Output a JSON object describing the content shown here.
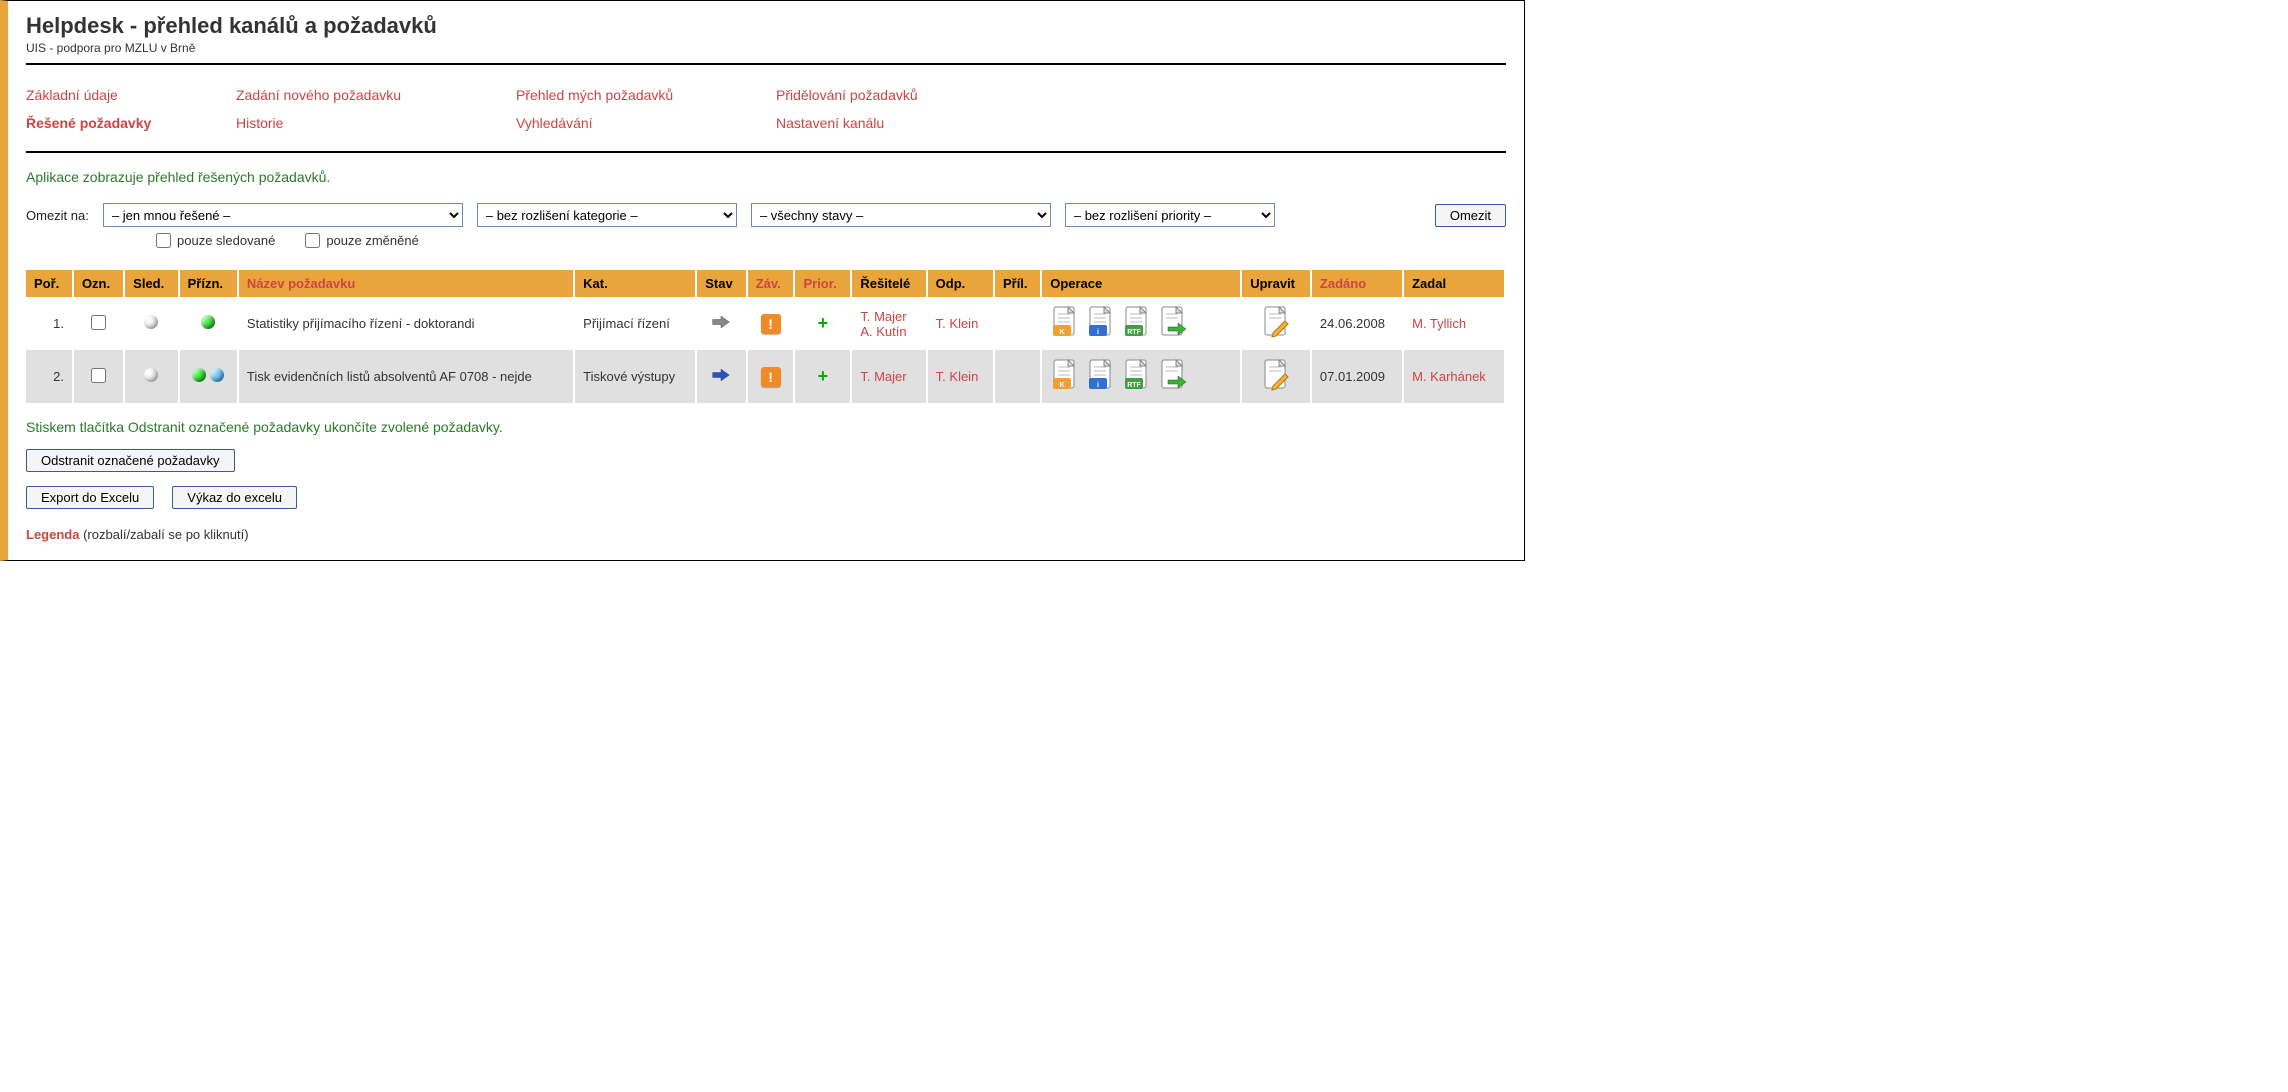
{
  "header": {
    "title": "Helpdesk - přehled kanálů a požadavků",
    "subtitle": "UIS - podpora pro MZLU v Brně"
  },
  "nav": {
    "row1": [
      "Základní údaje",
      "Zadání nového požadavku",
      "Přehled mých požadavků",
      "Přidělování požadavků"
    ],
    "row2": [
      "Řešené požadavky",
      "Historie",
      "Vyhledávání",
      "Nastavení kanálu"
    ],
    "active": "Řešené požadavky"
  },
  "intro": "Aplikace zobrazuje přehled řešených požadavků.",
  "filters": {
    "label": "Omezit na:",
    "select1": "– jen mnou řešené –",
    "select2": "– bez rozlišení kategorie –",
    "select3": "– všechny stavy –",
    "select4": "– bez rozlišení priority –",
    "submit": "Omezit",
    "chk1": "pouze sledované",
    "chk2": "pouze změněné"
  },
  "table": {
    "headers": {
      "por": "Poř.",
      "ozn": "Ozn.",
      "sled": "Sled.",
      "prizn": "Přízn.",
      "nazev": "Název požadavku",
      "kat": "Kat.",
      "stav": "Stav",
      "zav": "Záv.",
      "prior": "Prior.",
      "resitele": "Řešitelé",
      "odp": "Odp.",
      "pril": "Příl.",
      "operace": "Operace",
      "upravit": "Upravit",
      "zadano": "Zadáno",
      "zadal": "Zadal"
    },
    "rows": [
      {
        "por": "1.",
        "nazev": "Statistiky přijímacího řízení - doktorandi",
        "kat": "Přijímací řízení",
        "resitele": [
          "T. Majer",
          "A. Kutín"
        ],
        "odp": "T. Klein",
        "zadano": "24.06.2008",
        "zadal": "M. Tyllich",
        "arrow_color": "#888",
        "prizn_dots": [
          "green"
        ]
      },
      {
        "por": "2.",
        "nazev": "Tisk evidenčních listů absolventů AF 0708 - nejde",
        "kat": "Tiskové výstupy",
        "resitele": [
          "T. Majer"
        ],
        "odp": "T. Klein",
        "zadano": "07.01.2009",
        "zadal": "M. Karhánek",
        "arrow_color": "#2255cc",
        "prizn_dots": [
          "green",
          "blue"
        ]
      }
    ]
  },
  "hint": "Stiskem tlačítka Odstranit označené požadavky ukončíte zvolené požadavky.",
  "buttons": {
    "remove": "Odstranit označené požadavky",
    "export": "Export do Excelu",
    "vykaz": "Výkaz do excelu"
  },
  "legend": {
    "label": "Legenda",
    "hint": "(rozbalí/zabalí se po kliknutí)"
  }
}
